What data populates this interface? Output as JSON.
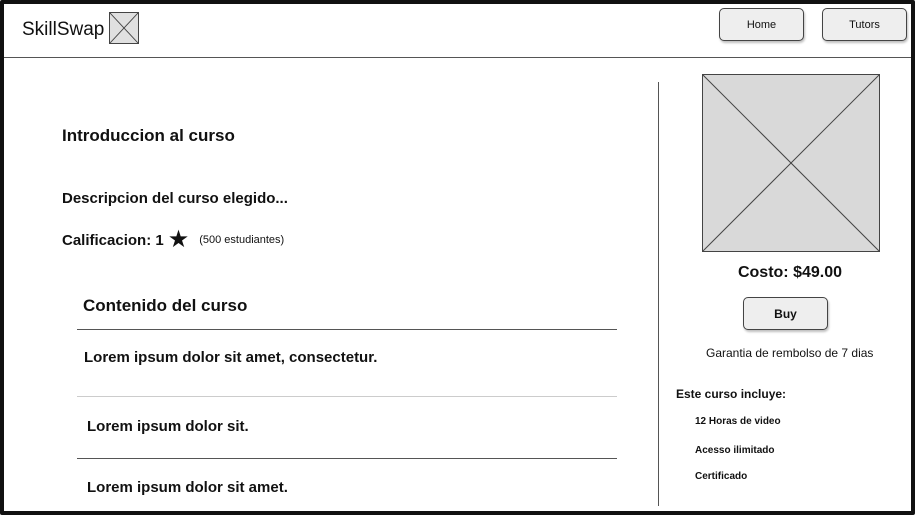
{
  "header": {
    "app_name": "SkillSwap",
    "nav": [
      {
        "label": "Home"
      },
      {
        "label": "Tutors"
      }
    ]
  },
  "course": {
    "title": "Introduccion al curso",
    "description": "Descripcion del curso elegido...",
    "rating_label": "Calificacion: 1",
    "rating_value": 1,
    "star_icon": "star-icon",
    "students": "(500 estudiantes)"
  },
  "content": {
    "title": "Contenido del curso",
    "lessons": [
      "Lorem ipsum dolor sit amet, consectetur.",
      "Lorem ipsum dolor sit.",
      "Lorem ipsum dolor sit amet."
    ]
  },
  "purchase": {
    "price": "Costo: $49.00",
    "buy_label": "Buy",
    "guarantee": "Garantia de rembolso de 7 dias",
    "includes_title": "Este curso incluye:",
    "includes": [
      "12 Horas de video",
      "Acesso ilimitado",
      "Certificado"
    ]
  }
}
